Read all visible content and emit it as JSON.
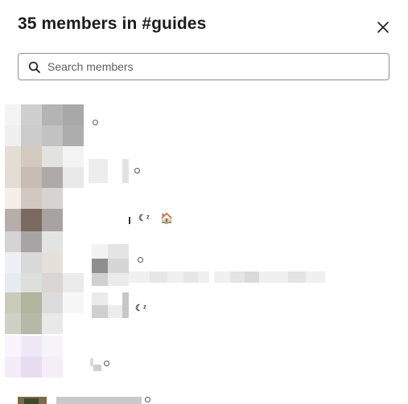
{
  "header": {
    "title": "35 members in #guides"
  },
  "search": {
    "placeholder": "Search members",
    "value": ""
  },
  "members": [
    {
      "status": "away"
    },
    {
      "status": "away"
    },
    {
      "status": "snoozed",
      "emoji": "🏠"
    },
    {
      "status": "away"
    },
    {
      "status": "snoozed"
    },
    {
      "status": "away"
    },
    {
      "status": "away",
      "name_partial": "Cl..."
    }
  ],
  "icons": {
    "close": "close-icon",
    "search": "search-icon",
    "status_away": "presence-away-icon",
    "status_snoozed": "snooze-icon",
    "emoji_home": "house-emoji-icon"
  },
  "colors": {
    "text": "#1d1c1d",
    "border": "#8f8f8f",
    "placeholder": "#616061"
  }
}
